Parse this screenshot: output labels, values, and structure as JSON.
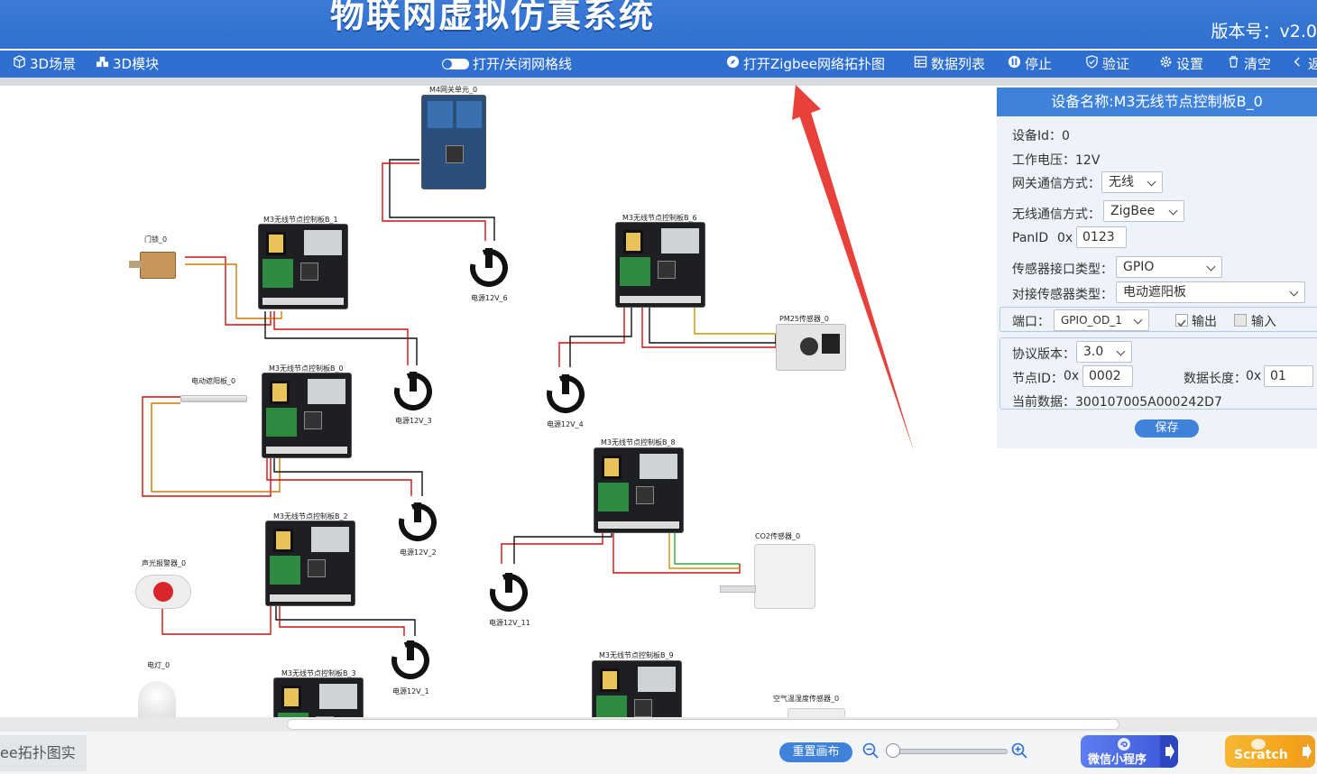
{
  "header": {
    "title": "物联网虚拟仿真系统",
    "version": "版本号：v2.0"
  },
  "toolbar": {
    "scene3d": "3D场景",
    "module3d": "3D模块",
    "grid_toggle": "打开/关闭网格线",
    "zigbee_topology": "打开Zigbee网络拓扑图",
    "data_list": "数据列表",
    "stop": "停止",
    "verify": "验证",
    "settings": "设置",
    "clear": "清空",
    "back": "返"
  },
  "canvas": {
    "gateway": "M4网关单元_0",
    "boards": [
      "M3无线节点控制板B_1",
      "M3无线节点控制板B_0",
      "M3无线节点控制板B_2",
      "M3无线节点控制板B_3",
      "M3无线节点控制板B_6",
      "M3无线节点控制板B_8",
      "M3无线节点控制板B_9"
    ],
    "power": [
      "电源12V_6",
      "电源12V_3",
      "电源12V_2",
      "电源12V_1",
      "电源12V_4",
      "电源12V_11"
    ],
    "devices": {
      "door_lock": "门锁_0",
      "blind": "电动遮阳板_0",
      "alarm": "声光报警器_0",
      "lamp": "电灯_0",
      "pm25": "PM25传感器_0",
      "co2": "CO2传感器_0",
      "air": "空气温湿度传感器_0"
    }
  },
  "panel": {
    "title": "设备名称:M3无线节点控制板B_0",
    "device_id": "设备Id：0",
    "voltage": "工作电压：12V",
    "gateway_comm_label": "网关通信方式：",
    "gateway_comm_value": "无线",
    "wireless_comm_label": "无线通信方式：",
    "wireless_comm_value": "ZigBee",
    "panid_label": "PanID",
    "panid_prefix": "0x",
    "panid_value": "0123",
    "sensor_iface_label": "传感器接口类型：",
    "sensor_iface_value": "GPIO",
    "sensor_type_label": "对接传感器类型：",
    "sensor_type_value": "电动遮阳板",
    "port_label": "端口：",
    "port_value": "GPIO_OD_1",
    "output_label": "输出",
    "input_label": "输入",
    "protocol_label": "协议版本：",
    "protocol_value": "3.0",
    "node_id_label": "节点ID：",
    "node_id_prefix": "0x",
    "node_id_value": "0002",
    "data_len_label": "数据长度：",
    "data_len_prefix": "0x",
    "data_len_value": "01",
    "current_data": "当前数据：300107005A000242D7",
    "save": "保存"
  },
  "bottom": {
    "tab": "ee拓扑图实",
    "reset": "重置画布",
    "mini_program": "微信小程序",
    "scratch": "Scratch"
  },
  "colors": {
    "primary": "#3f82db",
    "toolbar": "#2f6fcf",
    "arrow": "#e8403a",
    "wire_red": "#cc1111",
    "wire_black": "#111111"
  }
}
